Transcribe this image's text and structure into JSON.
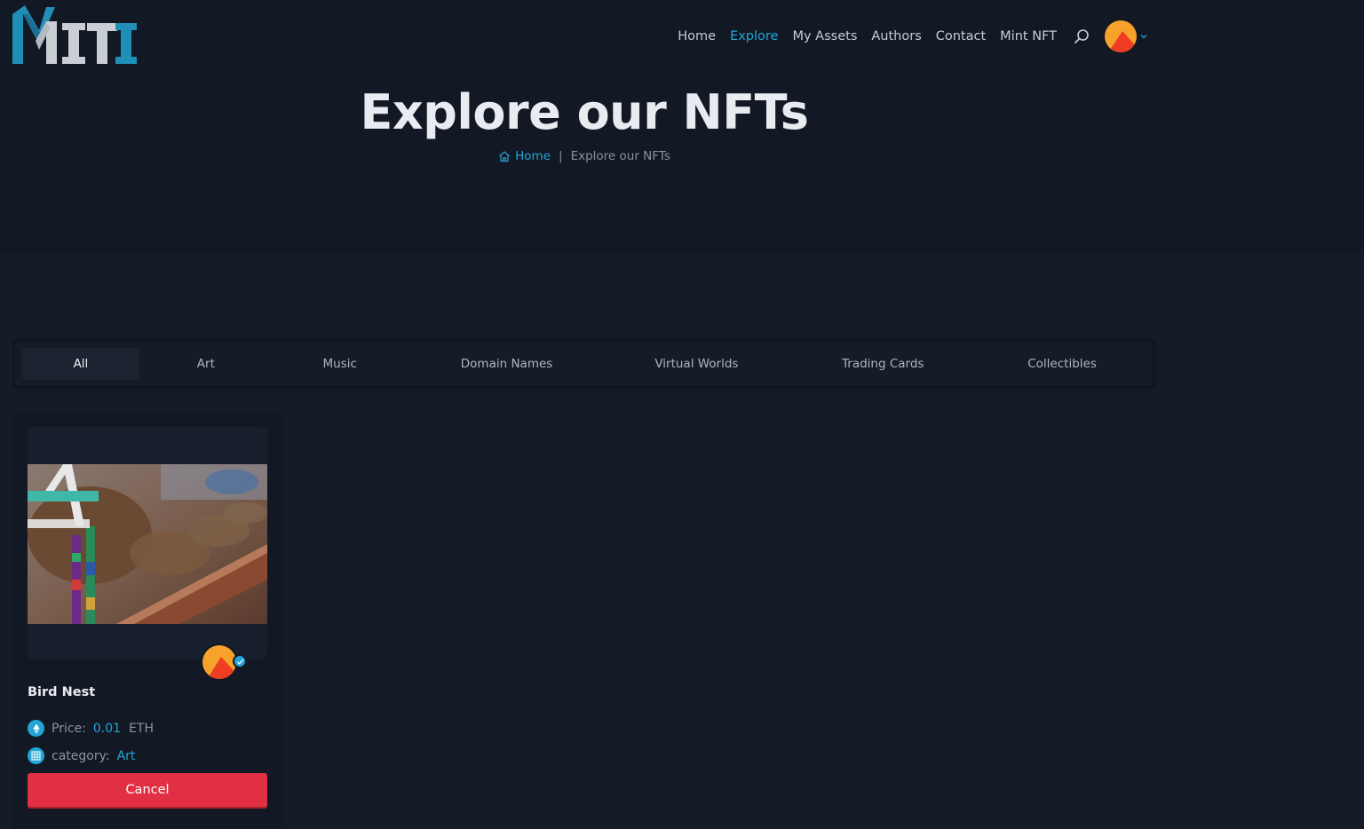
{
  "brand": {
    "logo_text": "MITI",
    "accent": "#23a6d5",
    "logo_silver": "#c9cdd4"
  },
  "nav": {
    "items": [
      {
        "label": "Home",
        "active": false
      },
      {
        "label": "Explore",
        "active": true
      },
      {
        "label": "My Assets",
        "active": false
      },
      {
        "label": "Authors",
        "active": false
      },
      {
        "label": "Contact",
        "active": false
      },
      {
        "label": "Mint NFT",
        "active": false
      }
    ],
    "search_icon": "search-icon",
    "avatar_icon": "user-avatar",
    "dropdown_icon": "chevron-down-icon"
  },
  "hero": {
    "title": "Explore our NFTs",
    "breadcrumb": {
      "home": "Home",
      "separator": "|",
      "current": "Explore our NFTs"
    }
  },
  "filters": {
    "tabs": [
      {
        "label": "All",
        "active": true
      },
      {
        "label": "Art",
        "active": false
      },
      {
        "label": "Music",
        "active": false
      },
      {
        "label": "Domain Names",
        "active": false
      },
      {
        "label": "Virtual Worlds",
        "active": false
      },
      {
        "label": "Trading Cards",
        "active": false
      },
      {
        "label": "Collectibles",
        "active": false
      }
    ]
  },
  "cards": [
    {
      "title": "Bird Nest",
      "price_label": "Price:",
      "price_value": "0.01",
      "price_unit": "ETH",
      "category_label": "category:",
      "category_value": "Art",
      "button_label": "Cancel",
      "button_color": "#e13044"
    }
  ]
}
